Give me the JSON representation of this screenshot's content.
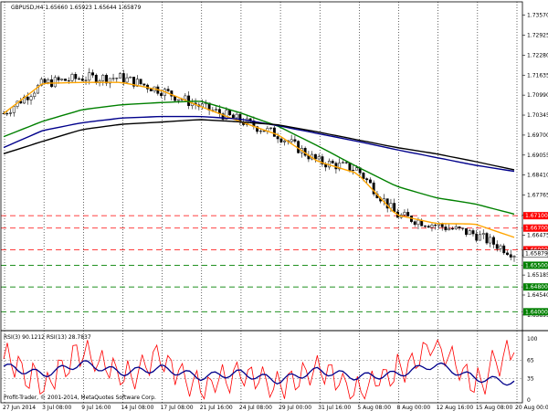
{
  "main_chart": {
    "header": "GBPUSD,H4  1.65660 1.65923 1.65644 1.65879",
    "price_scale": [
      "1.73570",
      "1.72925",
      "1.72280",
      "1.71635",
      "1.70990",
      "1.70345",
      "1.69700",
      "1.69055",
      "1.68410",
      "1.67765",
      "1.67120",
      "1.66475",
      "1.65830",
      "1.65185",
      "1.64540",
      "1.63895"
    ],
    "current_price": "1.65879",
    "levels": [
      {
        "label": "1.67100",
        "price": 1.671,
        "kind": "resistance",
        "color": "#ff0000"
      },
      {
        "label": "1.66700",
        "price": 1.667,
        "kind": "resistance",
        "color": "#ff0000"
      },
      {
        "label": "1.66000",
        "price": 1.66,
        "kind": "resistance",
        "color": "#ff0000"
      },
      {
        "label": "1.65500",
        "price": 1.655,
        "kind": "support",
        "color": "#008000"
      },
      {
        "label": "1.64800",
        "price": 1.648,
        "kind": "support",
        "color": "#008000"
      },
      {
        "label": "1.64000",
        "price": 1.64,
        "kind": "support",
        "color": "#008000"
      }
    ]
  },
  "chart_data": [
    {
      "type": "line",
      "title": "GBPUSD,H4",
      "x": [
        "27 Jun 2014",
        "3 Jul 08:00",
        "9 Jul 16:00",
        "14 Jul 08:00",
        "17 Jul 08:00",
        "21 Jul 16:00",
        "24 Jul 08:00",
        "29 Jul 00:00",
        "31 Jul 16:00",
        "5 Aug 08:00",
        "8 Aug 00:00",
        "12 Aug 16:00",
        "15 Aug 08:00",
        "20 Aug 00:00"
      ],
      "series": [
        {
          "name": "",
          "color": "#000000",
          "values": [
            1.704,
            1.7137,
            1.7155,
            1.7155,
            1.7115,
            1.7063,
            1.7018,
            1.697,
            1.6885,
            1.686,
            1.6712,
            1.668,
            1.665,
            1.6588
          ]
        },
        {
          "name": "",
          "color": "#ffa500",
          "values": [
            1.704,
            1.7137,
            1.714,
            1.714,
            1.7115,
            1.7063,
            1.7015,
            1.697,
            1.6885,
            1.6847,
            1.6712,
            1.6685,
            1.6683,
            1.664
          ]
        },
        {
          "name": "",
          "color": "#008000",
          "values": [
            1.6965,
            1.7015,
            1.7052,
            1.7068,
            1.7075,
            1.708,
            1.7043,
            1.6998,
            1.6935,
            1.6868,
            1.6805,
            1.6768,
            1.6748,
            1.6715
          ]
        },
        {
          "name": "",
          "color": "#00008b",
          "values": [
            1.693,
            1.6985,
            1.701,
            1.7025,
            1.703,
            1.703,
            1.7022,
            1.7,
            1.6975,
            1.695,
            1.6923,
            1.6898,
            1.6873,
            1.6853
          ]
        },
        {
          "name": "",
          "color": "#000000",
          "values": [
            1.691,
            1.695,
            1.6988,
            1.7005,
            1.7012,
            1.702,
            1.7013,
            1.7003,
            1.698,
            1.6955,
            1.693,
            1.691,
            1.6885,
            1.6858
          ]
        }
      ],
      "ylim": [
        1.6345,
        1.74
      ],
      "grid": true
    },
    {
      "type": "line",
      "title": "RSI(3) 90.1212  RSI(13) 28.7837",
      "x": [
        "27 Jun 2014",
        "3 Jul 08:00",
        "9 Jul 16:00",
        "14 Jul 08:00",
        "17 Jul 08:00",
        "21 Jul 16:00",
        "24 Jul 08:00",
        "29 Jul 00:00",
        "31 Jul 16:00",
        "5 Aug 08:00",
        "8 Aug 00:00",
        "12 Aug 16:00",
        "15 Aug 08:00",
        "20 Aug 00:00"
      ],
      "series": [
        {
          "name": "RSI(3)",
          "color": "#ff0000",
          "values": [
            72,
            25,
            85,
            35,
            68,
            18,
            42,
            20,
            58,
            15,
            45,
            92,
            20,
            90
          ]
        },
        {
          "name": "RSI(13)",
          "color": "#00008b",
          "values": [
            55,
            42,
            60,
            45,
            52,
            38,
            44,
            32,
            48,
            38,
            42,
            58,
            36,
            29
          ]
        }
      ],
      "ylim": [
        0,
        100
      ],
      "yticks": [
        "100",
        "65",
        "35",
        "0"
      ],
      "grid": true
    }
  ],
  "indicator": {
    "header": "RSI(3) 90.1212  RSI(13) 28.7837",
    "scale": [
      "100",
      "65",
      "35",
      "0"
    ],
    "copyright": "Profit-Trader, © 2001-2014, MetaQuotes Software Corp."
  },
  "time_axis": [
    "27 Jun 2014",
    "3 Jul 08:00",
    "9 Jul 16:00",
    "14 Jul 08:00",
    "17 Jul 08:00",
    "21 Jul 16:00",
    "24 Jul 08:00",
    "29 Jul 00:00",
    "31 Jul 16:00",
    "5 Aug 08:00",
    "8 Aug 00:00",
    "12 Aug 16:00",
    "15 Aug 08:00",
    "20 Aug 00:00"
  ]
}
